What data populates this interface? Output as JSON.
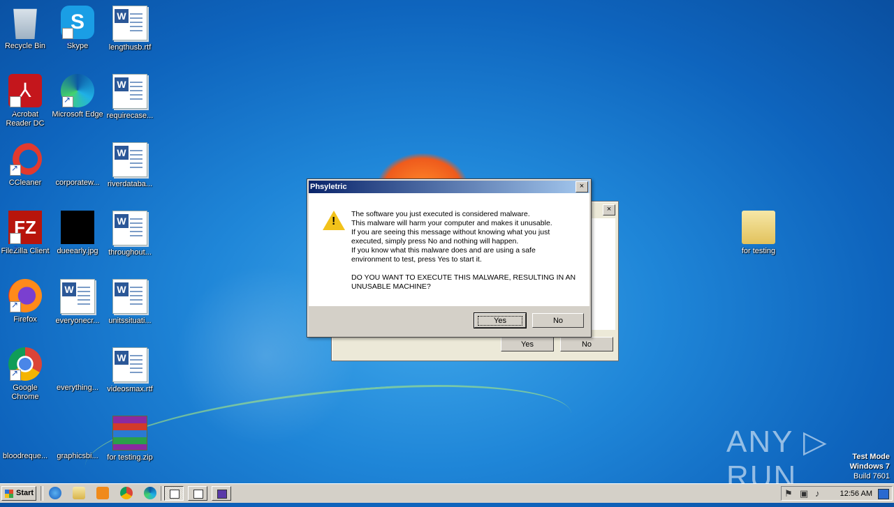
{
  "desktop": {
    "icons": [
      {
        "label": "Recycle Bin"
      },
      {
        "label": "Skype"
      },
      {
        "label": "lengthusb.rtf"
      },
      {
        "label": "Acrobat Reader DC"
      },
      {
        "label": "Microsoft Edge"
      },
      {
        "label": "requirecase..."
      },
      {
        "label": "CCleaner"
      },
      {
        "label": "corporatew..."
      },
      {
        "label": "riverdataba..."
      },
      {
        "label": "FileZilla Client"
      },
      {
        "label": "dueearly.jpg"
      },
      {
        "label": "throughout..."
      },
      {
        "label": "Firefox"
      },
      {
        "label": "everyonecr..."
      },
      {
        "label": "unitssituati..."
      },
      {
        "label": "Google Chrome"
      },
      {
        "label": "everything..."
      },
      {
        "label": "videosmax.rtf"
      },
      {
        "label": "bloodreque..."
      },
      {
        "label": "graphicsbi..."
      },
      {
        "label": "for testing.zip"
      },
      {
        "label": "for testing"
      }
    ]
  },
  "dialog_back": {
    "yes_label": "Yes",
    "no_label": "No",
    "close_glyph": "×"
  },
  "dialog": {
    "title": "Phsyletric",
    "close_glyph": "×",
    "warning_glyph": "!",
    "lines": [
      "The software you just executed is considered malware.",
      "This malware will harm your computer and makes it unusable.",
      "If you are seeing this message without knowing what you just",
      "executed, simply press No and nothing will happen.",
      "If you know what this malware does and are using a safe",
      "environment to test, press Yes to start it."
    ],
    "question_lines": [
      "DO YOU WANT TO EXECUTE THIS MALWARE, RESULTING IN AN",
      "UNUSABLE MACHINE?"
    ],
    "yes_label": "Yes",
    "no_label": "No"
  },
  "watermark": {
    "text": "ANY ▷ RUN"
  },
  "test_mode": {
    "line1": "Test Mode",
    "line2": "Windows 7",
    "line3": "Build 7601"
  },
  "taskbar": {
    "start_label": "Start",
    "clock": "12:56 AM",
    "colors": {
      "taskbar_bg": "#d4d0c8",
      "title_start": "#0a246a",
      "title_end": "#a6caf0"
    }
  }
}
